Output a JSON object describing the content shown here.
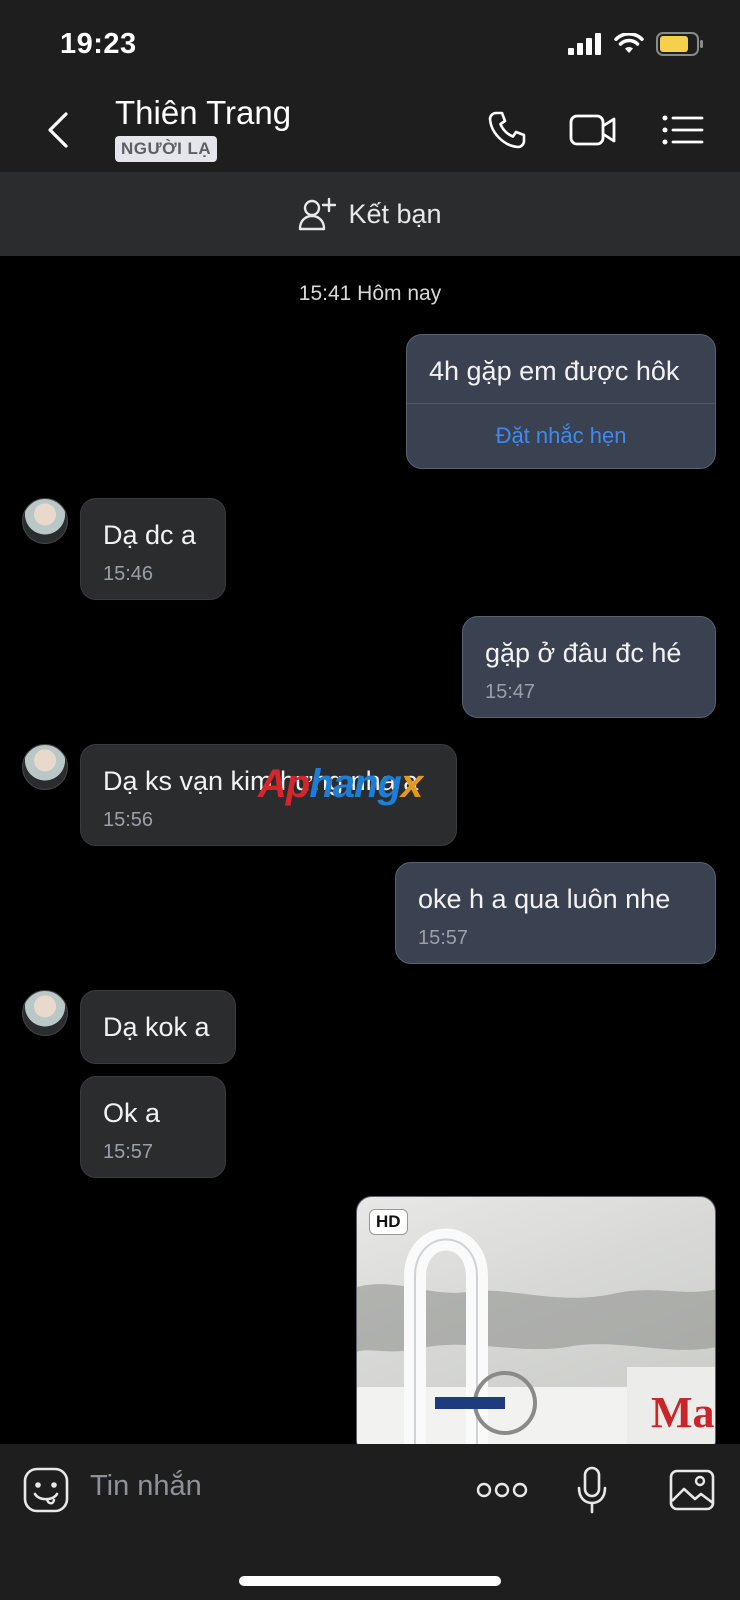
{
  "status_bar": {
    "time": "19:23"
  },
  "header": {
    "contact_name": "Thiên Trang",
    "stranger_badge": "NGƯỜI LẠ"
  },
  "add_friend": {
    "label": "Kết bạn"
  },
  "chat": {
    "date_separator": "15:41 Hôm nay",
    "messages": [
      {
        "side": "sent",
        "text": "4h gặp em được hôk",
        "reminder_link": "Đặt nhắc hẹn"
      },
      {
        "side": "recv",
        "text": "Dạ dc a",
        "time": "15:46"
      },
      {
        "side": "sent",
        "text": "gặp ở đâu đc hé",
        "time": "15:47"
      },
      {
        "side": "recv",
        "text": "Dạ ks vạn kim hưng nha a",
        "time": "15:56"
      },
      {
        "side": "sent",
        "text": "oke h a qua luôn nhe",
        "time": "15:57"
      },
      {
        "side": "recv",
        "text": "Dạ kok a"
      },
      {
        "side": "recv",
        "text": "Ok a",
        "time": "15:57"
      }
    ],
    "image_badge": "HD",
    "watermark": {
      "part1": "Ap",
      "part2": "hang",
      "part3": "x"
    }
  },
  "input_bar": {
    "placeholder": "Tin nhắn"
  },
  "colors": {
    "bar_bg": "#1e1e1f",
    "sent_bubble": "#3a4150",
    "recv_bubble": "#2b2c2e",
    "link_blue": "#3d8bf2",
    "battery_yellow": "#f5d04a"
  },
  "icons": [
    "signal-icon",
    "wifi-icon",
    "battery-icon",
    "back-icon",
    "phone-icon",
    "video-call-icon",
    "menu-list-icon",
    "add-friend-icon",
    "emoji-icon",
    "more-icon",
    "microphone-icon",
    "gallery-icon"
  ]
}
